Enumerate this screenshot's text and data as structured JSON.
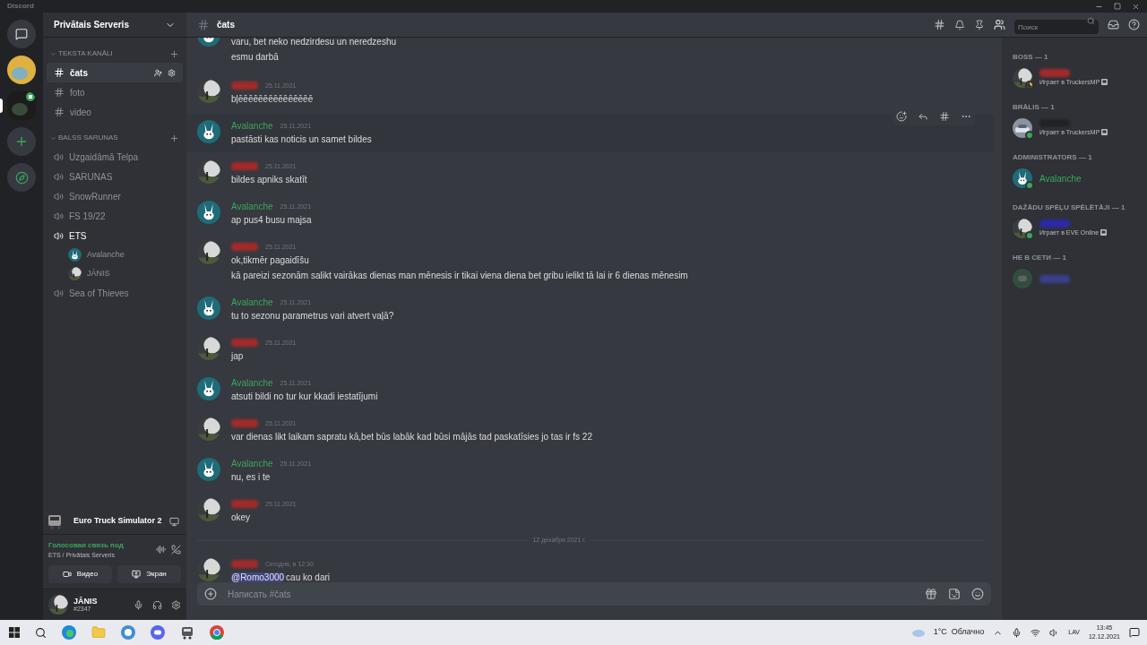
{
  "window": {
    "title": "Discord"
  },
  "server_rail": [
    {
      "kind": "home",
      "selected": false
    },
    {
      "kind": "server",
      "selected": false,
      "voice": false
    },
    {
      "kind": "server",
      "selected": true,
      "voice": true
    },
    {
      "kind": "add"
    },
    {
      "kind": "explore"
    }
  ],
  "sidebar": {
    "server_name": "Privātais Serveris",
    "categories": [
      {
        "name": "TEKSTA KANĀLI",
        "channels": [
          {
            "kind": "text",
            "name": "čats",
            "selected": true
          },
          {
            "kind": "text",
            "name": "foto",
            "selected": false
          },
          {
            "kind": "text",
            "name": "video",
            "selected": false
          }
        ]
      },
      {
        "name": "BALSS SARUNAS",
        "channels": [
          {
            "kind": "voice",
            "name": "Uzgaidāmā Telpa",
            "selected": false
          },
          {
            "kind": "voice",
            "name": "SARUNAS",
            "selected": false
          },
          {
            "kind": "voice",
            "name": "SnowRunner",
            "selected": false
          },
          {
            "kind": "voice",
            "name": "FS 19/22",
            "selected": false
          },
          {
            "kind": "voice",
            "name": "ETS",
            "selected": true,
            "children": [
              {
                "name": "Avalanche"
              },
              {
                "name": "JĀNIS"
              }
            ]
          },
          {
            "kind": "voice",
            "name": "Sea of Thieves",
            "selected": false
          }
        ]
      }
    ]
  },
  "activity": {
    "game": "Euro Truck Simulator 2"
  },
  "voice_panel": {
    "status": "Голосовая связь под",
    "location": "ETS / Privātais Serveris",
    "buttons": [
      "Видео",
      "Экран"
    ]
  },
  "user": {
    "name": "JĀNIS",
    "tag": "#2347"
  },
  "header": {
    "channel": "čats",
    "search": {
      "placeholder": "Поиск"
    }
  },
  "messages": [
    {
      "kind": "continued",
      "lines": [
        "varu, bet neko nedzirdesu un neredzeshu",
        "esmu darbā"
      ]
    },
    {
      "kind": "redacted",
      "color": "#a32a2a",
      "time": "25.11.2021",
      "hovered": false,
      "lines": [
        "bļēēēēēēēēēēēēēēē"
      ]
    },
    {
      "kind": "named",
      "author": "Avalanche",
      "color": "#3ba55d",
      "time": "25.11.2021",
      "hovered": true,
      "lines": [
        "pastāsti kas noticis un samet bildes"
      ]
    },
    {
      "kind": "redacted",
      "color": "#a32a2a",
      "time": "25.11.2021",
      "hovered": false,
      "lines": [
        "bildes apniks skatīt"
      ]
    },
    {
      "kind": "named",
      "author": "Avalanche",
      "color": "#3ba55d",
      "time": "25.11.2021",
      "hovered": false,
      "lines": [
        "ap pus4 busu majsa"
      ]
    },
    {
      "kind": "redacted",
      "color": "#a32a2a",
      "time": "25.11.2021",
      "hovered": false,
      "lines": [
        "ok,tikmēr pagaidīšu",
        "kā pareizi sezonām salikt vairākas dienas man mēnesis ir tikai viena diena bet gribu ielikt tā lai ir 6 dienas mēnesim"
      ]
    },
    {
      "kind": "named",
      "author": "Avalanche",
      "color": "#3ba55d",
      "time": "25.11.2021",
      "hovered": false,
      "lines": [
        "tu to sezonu parametrus vari atvert vaļā?"
      ]
    },
    {
      "kind": "redacted",
      "color": "#a32a2a",
      "time": "25.11.2021",
      "hovered": false,
      "lines": [
        "jap"
      ]
    },
    {
      "kind": "named",
      "author": "Avalanche",
      "color": "#3ba55d",
      "time": "25.11.2021",
      "hovered": false,
      "lines": [
        "atsuti bildi no tur kur kkadi iestatījumi"
      ]
    },
    {
      "kind": "redacted",
      "color": "#a32a2a",
      "time": "25.11.2021",
      "hovered": false,
      "lines": [
        "var dienas likt laikam sapratu kā,bet būs labāk kad būsi mājās tad paskatīsies jo tas ir fs 22"
      ]
    },
    {
      "kind": "named",
      "author": "Avalanche",
      "color": "#3ba55d",
      "time": "25.11.2021",
      "hovered": false,
      "lines": [
        "nu, es i te"
      ]
    },
    {
      "kind": "redacted",
      "color": "#a32a2a",
      "time": "25.11.2021",
      "hovered": false,
      "lines": [
        "okey"
      ]
    },
    {
      "kind": "divider",
      "label": "12 декабря 2021 г."
    },
    {
      "kind": "redacted",
      "color": "#a32a2a",
      "time": "Сегодня, в 12:30",
      "hovered": false,
      "mention": "@Romo3000",
      "lines": [
        "cau ko dari"
      ]
    }
  ],
  "composer": {
    "placeholder": "Написать #čats"
  },
  "members": [
    {
      "group": "BOSS — 1",
      "items": [
        {
          "kind": "redacted",
          "color": "#a32a2a",
          "online": true,
          "idle": true,
          "activity": "Играет в TruckersMP"
        }
      ]
    },
    {
      "group": "BRĀLIS — 1",
      "items": [
        {
          "kind": "redacted",
          "color": "#202225",
          "online": true,
          "idle": false,
          "activity": "Играет в TruckersMP"
        }
      ]
    },
    {
      "group": "ADMINISTRATORS — 1",
      "items": [
        {
          "kind": "named",
          "name": "Avalanche",
          "color": "#3ba55d",
          "online": true,
          "idle": false
        }
      ]
    },
    {
      "group": "DAŽĀDU SPĒĻU SPĒLĒTĀJI — 1",
      "items": [
        {
          "kind": "redacted",
          "color": "#2a2aa8",
          "online": true,
          "idle": false,
          "activity": "Играет в EVE Online"
        }
      ]
    },
    {
      "group": "НЕ В СЕТИ — 1",
      "items": [
        {
          "kind": "redacted",
          "color": "#3a3f8a",
          "online": false
        }
      ]
    }
  ],
  "taskbar": {
    "weather": "1°C  Облачно",
    "language": "LAV",
    "time": "13:45",
    "date": "12.12.2021"
  }
}
